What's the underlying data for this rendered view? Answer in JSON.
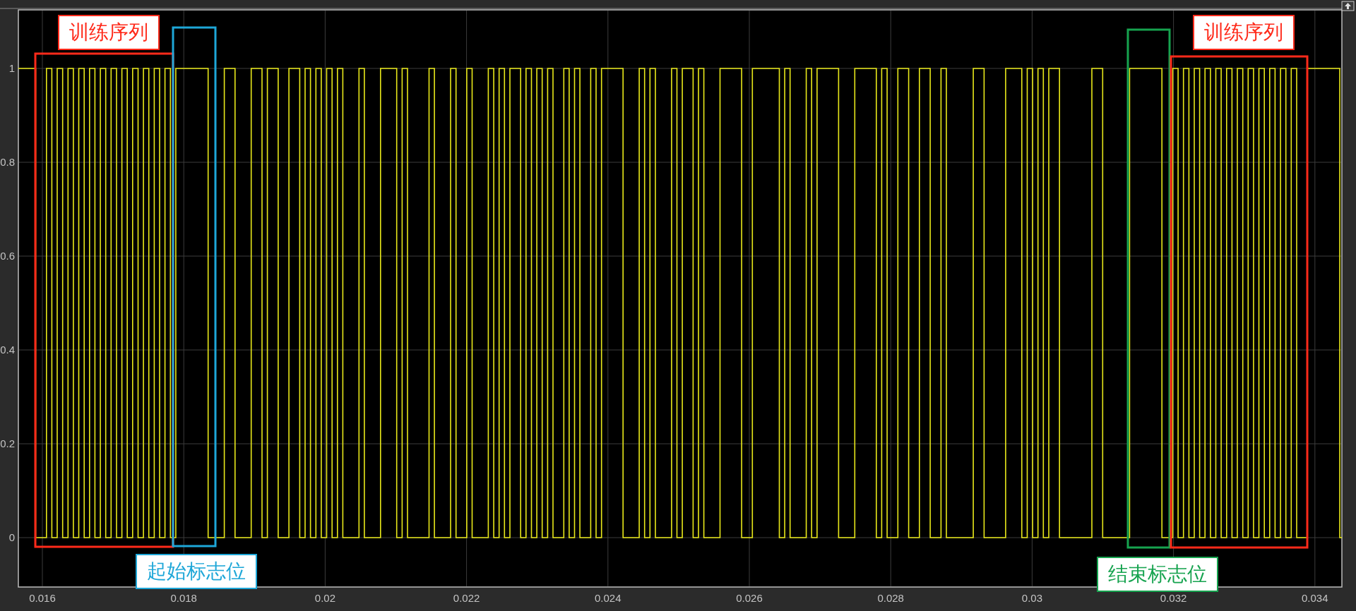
{
  "plot": {
    "y_ticks": [
      "1",
      "0.8",
      "0.6",
      "0.4",
      "0.2",
      "0"
    ],
    "x_ticks": [
      "0.016",
      "0.018",
      "0.02",
      "0.022",
      "0.024",
      "0.026",
      "0.028",
      "0.03",
      "0.032",
      "0.034"
    ],
    "annotations": [
      {
        "label": "训练序列",
        "color": "#ff2a1a"
      },
      {
        "label": "起始标志位",
        "color": "#1ea7d8"
      },
      {
        "label": "结束标志位",
        "color": "#16a34f"
      },
      {
        "label": "训练序列",
        "color": "#ff2a1a"
      }
    ]
  }
}
